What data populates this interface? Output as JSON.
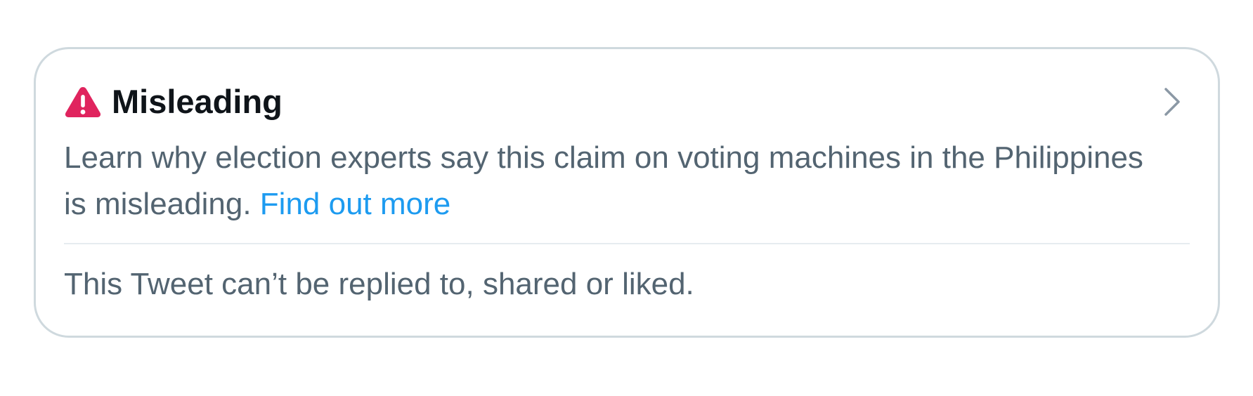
{
  "notice": {
    "label": "Misleading",
    "label_icon": "warning-triangle-icon",
    "description": "Learn why election experts say this claim on voting machines in the Philippines is misleading.",
    "link_text": "Find out more",
    "restriction_text": "This Tweet can’t be replied to, shared or liked.",
    "chevron_icon": "chevron-right-icon"
  },
  "colors": {
    "warning": "#e0245e",
    "link": "#1d9bf0",
    "title": "#0f1419",
    "body_text": "#536471",
    "border": "#cfd9de"
  }
}
